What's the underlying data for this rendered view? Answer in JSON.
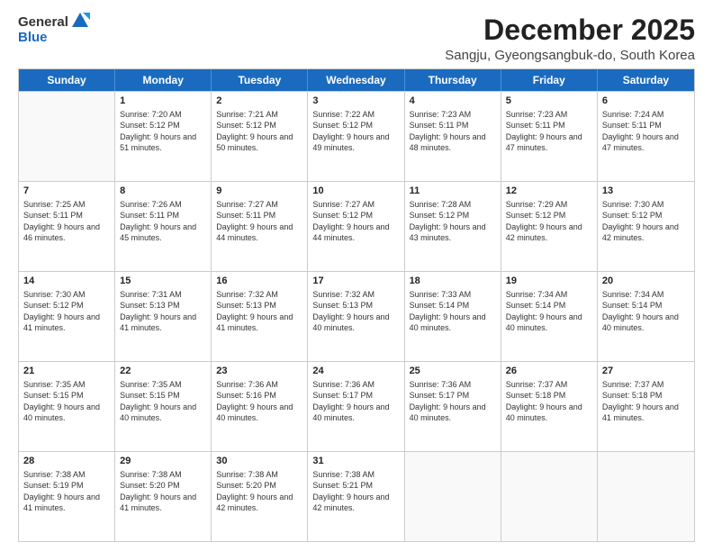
{
  "logo": {
    "general": "General",
    "blue": "Blue"
  },
  "title": "December 2025",
  "location": "Sangju, Gyeongsangbuk-do, South Korea",
  "days": [
    "Sunday",
    "Monday",
    "Tuesday",
    "Wednesday",
    "Thursday",
    "Friday",
    "Saturday"
  ],
  "weeks": [
    [
      {
        "day": "",
        "sunrise": "",
        "sunset": "",
        "daylight": ""
      },
      {
        "day": "1",
        "sunrise": "Sunrise: 7:20 AM",
        "sunset": "Sunset: 5:12 PM",
        "daylight": "Daylight: 9 hours and 51 minutes."
      },
      {
        "day": "2",
        "sunrise": "Sunrise: 7:21 AM",
        "sunset": "Sunset: 5:12 PM",
        "daylight": "Daylight: 9 hours and 50 minutes."
      },
      {
        "day": "3",
        "sunrise": "Sunrise: 7:22 AM",
        "sunset": "Sunset: 5:12 PM",
        "daylight": "Daylight: 9 hours and 49 minutes."
      },
      {
        "day": "4",
        "sunrise": "Sunrise: 7:23 AM",
        "sunset": "Sunset: 5:11 PM",
        "daylight": "Daylight: 9 hours and 48 minutes."
      },
      {
        "day": "5",
        "sunrise": "Sunrise: 7:23 AM",
        "sunset": "Sunset: 5:11 PM",
        "daylight": "Daylight: 9 hours and 47 minutes."
      },
      {
        "day": "6",
        "sunrise": "Sunrise: 7:24 AM",
        "sunset": "Sunset: 5:11 PM",
        "daylight": "Daylight: 9 hours and 47 minutes."
      }
    ],
    [
      {
        "day": "7",
        "sunrise": "Sunrise: 7:25 AM",
        "sunset": "Sunset: 5:11 PM",
        "daylight": "Daylight: 9 hours and 46 minutes."
      },
      {
        "day": "8",
        "sunrise": "Sunrise: 7:26 AM",
        "sunset": "Sunset: 5:11 PM",
        "daylight": "Daylight: 9 hours and 45 minutes."
      },
      {
        "day": "9",
        "sunrise": "Sunrise: 7:27 AM",
        "sunset": "Sunset: 5:11 PM",
        "daylight": "Daylight: 9 hours and 44 minutes."
      },
      {
        "day": "10",
        "sunrise": "Sunrise: 7:27 AM",
        "sunset": "Sunset: 5:12 PM",
        "daylight": "Daylight: 9 hours and 44 minutes."
      },
      {
        "day": "11",
        "sunrise": "Sunrise: 7:28 AM",
        "sunset": "Sunset: 5:12 PM",
        "daylight": "Daylight: 9 hours and 43 minutes."
      },
      {
        "day": "12",
        "sunrise": "Sunrise: 7:29 AM",
        "sunset": "Sunset: 5:12 PM",
        "daylight": "Daylight: 9 hours and 42 minutes."
      },
      {
        "day": "13",
        "sunrise": "Sunrise: 7:30 AM",
        "sunset": "Sunset: 5:12 PM",
        "daylight": "Daylight: 9 hours and 42 minutes."
      }
    ],
    [
      {
        "day": "14",
        "sunrise": "Sunrise: 7:30 AM",
        "sunset": "Sunset: 5:12 PM",
        "daylight": "Daylight: 9 hours and 41 minutes."
      },
      {
        "day": "15",
        "sunrise": "Sunrise: 7:31 AM",
        "sunset": "Sunset: 5:13 PM",
        "daylight": "Daylight: 9 hours and 41 minutes."
      },
      {
        "day": "16",
        "sunrise": "Sunrise: 7:32 AM",
        "sunset": "Sunset: 5:13 PM",
        "daylight": "Daylight: 9 hours and 41 minutes."
      },
      {
        "day": "17",
        "sunrise": "Sunrise: 7:32 AM",
        "sunset": "Sunset: 5:13 PM",
        "daylight": "Daylight: 9 hours and 40 minutes."
      },
      {
        "day": "18",
        "sunrise": "Sunrise: 7:33 AM",
        "sunset": "Sunset: 5:14 PM",
        "daylight": "Daylight: 9 hours and 40 minutes."
      },
      {
        "day": "19",
        "sunrise": "Sunrise: 7:34 AM",
        "sunset": "Sunset: 5:14 PM",
        "daylight": "Daylight: 9 hours and 40 minutes."
      },
      {
        "day": "20",
        "sunrise": "Sunrise: 7:34 AM",
        "sunset": "Sunset: 5:14 PM",
        "daylight": "Daylight: 9 hours and 40 minutes."
      }
    ],
    [
      {
        "day": "21",
        "sunrise": "Sunrise: 7:35 AM",
        "sunset": "Sunset: 5:15 PM",
        "daylight": "Daylight: 9 hours and 40 minutes."
      },
      {
        "day": "22",
        "sunrise": "Sunrise: 7:35 AM",
        "sunset": "Sunset: 5:15 PM",
        "daylight": "Daylight: 9 hours and 40 minutes."
      },
      {
        "day": "23",
        "sunrise": "Sunrise: 7:36 AM",
        "sunset": "Sunset: 5:16 PM",
        "daylight": "Daylight: 9 hours and 40 minutes."
      },
      {
        "day": "24",
        "sunrise": "Sunrise: 7:36 AM",
        "sunset": "Sunset: 5:17 PM",
        "daylight": "Daylight: 9 hours and 40 minutes."
      },
      {
        "day": "25",
        "sunrise": "Sunrise: 7:36 AM",
        "sunset": "Sunset: 5:17 PM",
        "daylight": "Daylight: 9 hours and 40 minutes."
      },
      {
        "day": "26",
        "sunrise": "Sunrise: 7:37 AM",
        "sunset": "Sunset: 5:18 PM",
        "daylight": "Daylight: 9 hours and 40 minutes."
      },
      {
        "day": "27",
        "sunrise": "Sunrise: 7:37 AM",
        "sunset": "Sunset: 5:18 PM",
        "daylight": "Daylight: 9 hours and 41 minutes."
      }
    ],
    [
      {
        "day": "28",
        "sunrise": "Sunrise: 7:38 AM",
        "sunset": "Sunset: 5:19 PM",
        "daylight": "Daylight: 9 hours and 41 minutes."
      },
      {
        "day": "29",
        "sunrise": "Sunrise: 7:38 AM",
        "sunset": "Sunset: 5:20 PM",
        "daylight": "Daylight: 9 hours and 41 minutes."
      },
      {
        "day": "30",
        "sunrise": "Sunrise: 7:38 AM",
        "sunset": "Sunset: 5:20 PM",
        "daylight": "Daylight: 9 hours and 42 minutes."
      },
      {
        "day": "31",
        "sunrise": "Sunrise: 7:38 AM",
        "sunset": "Sunset: 5:21 PM",
        "daylight": "Daylight: 9 hours and 42 minutes."
      },
      {
        "day": "",
        "sunrise": "",
        "sunset": "",
        "daylight": ""
      },
      {
        "day": "",
        "sunrise": "",
        "sunset": "",
        "daylight": ""
      },
      {
        "day": "",
        "sunrise": "",
        "sunset": "",
        "daylight": ""
      }
    ]
  ]
}
